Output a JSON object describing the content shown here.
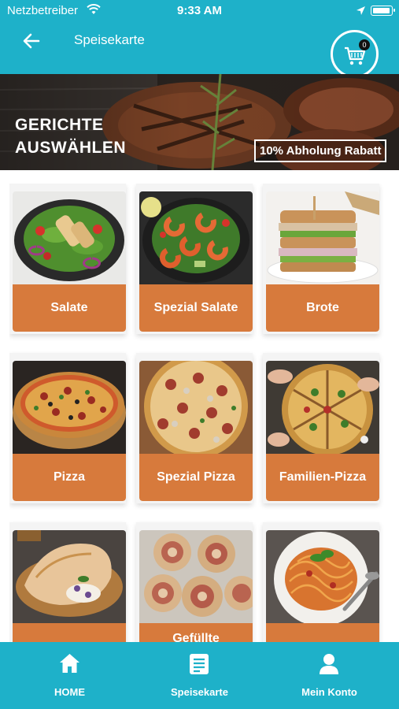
{
  "status_bar": {
    "carrier": "Netzbetreiber",
    "time": "9:33 AM"
  },
  "app_bar": {
    "title": "Speisekarte",
    "cart_count": "0"
  },
  "hero": {
    "heading_line1": "GERICHTE",
    "heading_line2": "AUSWÄHLEN",
    "badge": "10% Abholung Rabatt"
  },
  "categories": [
    {
      "label": "Salate"
    },
    {
      "label": "Spezial Salate"
    },
    {
      "label": "Brote"
    },
    {
      "label": "Pizza"
    },
    {
      "label": "Spezial Pizza"
    },
    {
      "label": "Familien-Pizza"
    },
    {
      "label": ""
    },
    {
      "label": "Gefüllte"
    },
    {
      "label": ""
    }
  ],
  "tab_bar": {
    "tabs": [
      {
        "label": "HOME",
        "icon": "home-icon"
      },
      {
        "label": "Speisekarte",
        "icon": "menu-document-icon"
      },
      {
        "label": "Mein Konto",
        "icon": "user-icon"
      }
    ]
  },
  "colors": {
    "primary": "#1eb1c9",
    "accent": "#d77a3c"
  }
}
